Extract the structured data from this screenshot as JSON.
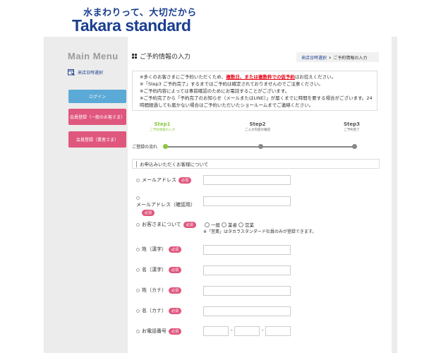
{
  "header": {
    "tagline": "水まわりって、大切だから",
    "logo": "Takara standard"
  },
  "sidebar": {
    "main_menu": "Main Menu",
    "store_select": "来店日時選択",
    "login": "ログイン",
    "register_general": "会員登録（一般のお客さま）",
    "register_business": "会員登録（業者さま）"
  },
  "page": {
    "title": "ご予約情報の入力"
  },
  "breadcrumb": {
    "link": "来店日時選択",
    "current": "ご予約情報の入力"
  },
  "notice": {
    "line1_pre": "※多くのお客さまにご予約いただくため、",
    "line1_red": "複数日、または複数枠での仮予約",
    "line1_post": "はお控えください。",
    "line2": "※「Step3 ご予約完了」するまではご予約は確定されておりませんのでご注意ください。",
    "line3": "※ご予約内容によっては事前確認のためにお電話することがございます。",
    "line4": "※ご予約完了から「予約完了のお知らせ（メールまたはLINE）」が届くまでに時間を要する場合がございます。24時間経過しても届かない場合はご予約いただいたショールームまでご連絡ください。"
  },
  "steps": [
    {
      "label": "Step1",
      "sub": "ご予約情報の入力"
    },
    {
      "label": "Step2",
      "sub": "ご入力内容の確認"
    },
    {
      "label": "Step3",
      "sub": "ご予約完了"
    }
  ],
  "flow_label": "ご登録の流れ",
  "section_title": "お申込みいただくお客様について",
  "required": "必須",
  "fields": {
    "email": "メールアドレス",
    "email_confirm": "メールアドレス（確認用）",
    "customer_type": "お客さまについて",
    "last_kanji": "姓（漢字）",
    "first_kanji": "名（漢字）",
    "last_kana": "姓（カナ）",
    "first_kana": "名（カナ）",
    "phone": "お電話番号"
  },
  "customer_options": [
    "一般",
    "業者",
    "営業"
  ],
  "customer_note": "※「営業」はタカラスタンダード社員のみが登録できます。",
  "phone_sep": "-"
}
